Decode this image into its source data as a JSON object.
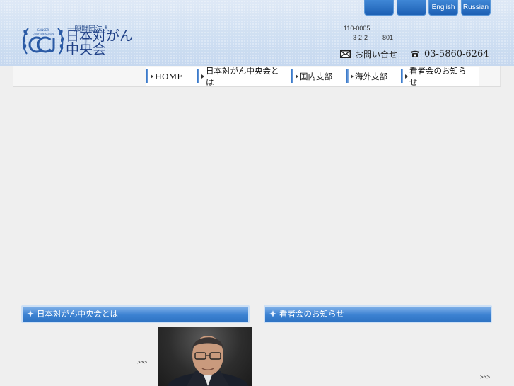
{
  "languages": [
    {
      "label": ""
    },
    {
      "label": ""
    },
    {
      "label": "English"
    },
    {
      "label": "Russian"
    }
  ],
  "logo": {
    "sub": "一般財団法人",
    "main": "日本対がん中央会",
    "emblem_text": "CCJ"
  },
  "address": {
    "postal": "110-0005",
    "line": "3-2-2",
    "room": "801"
  },
  "contact": {
    "label": "お問い合せ"
  },
  "tel": {
    "number": "03-5860-6264"
  },
  "nav": [
    {
      "label": "HOME"
    },
    {
      "label": "日本対がん中央会とは"
    },
    {
      "label": "国内支部"
    },
    {
      "label": "海外支部"
    },
    {
      "label": "看者会のお知らせ"
    }
  ],
  "sections": {
    "about": {
      "title": "日本対がん中央会とは",
      "more": "　　　　>>>"
    },
    "notice": {
      "title": "看者会のお知らせ",
      "more": "　　　　>>>"
    }
  },
  "colors": {
    "accent": "#2f74c4",
    "header_bg": "#d4e3f4"
  }
}
